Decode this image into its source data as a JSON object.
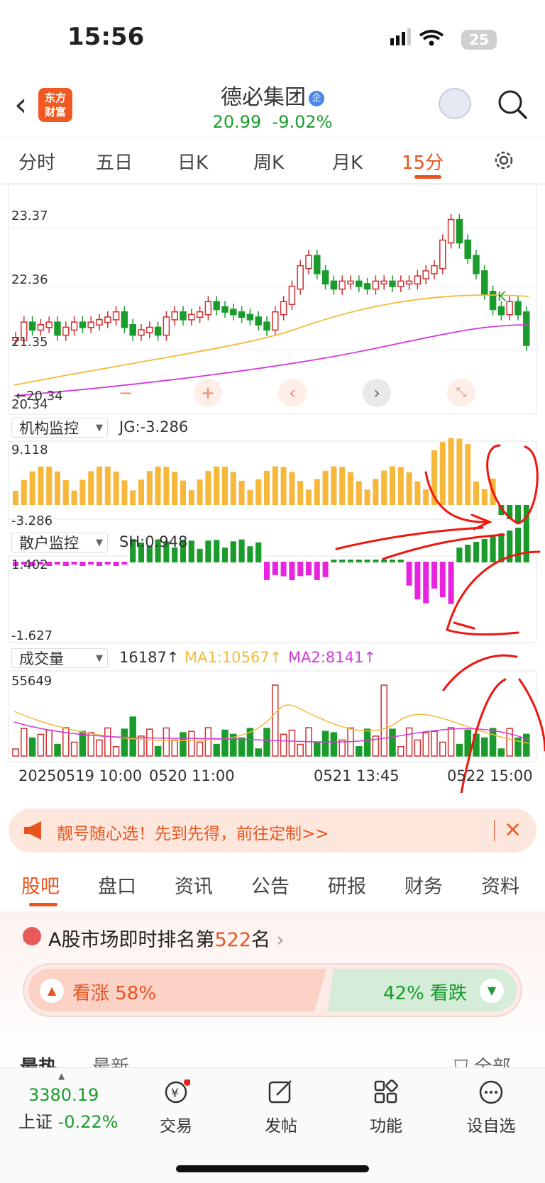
{
  "status": {
    "time": "15:56",
    "battery": "25"
  },
  "header": {
    "logo_line1": "东方",
    "logo_line2": "财富",
    "stock_name": "德必集团",
    "tag": "企",
    "price": "20.99",
    "change": "-9.02%"
  },
  "tabs": [
    "分时",
    "五日",
    "日K",
    "周K",
    "月K",
    "15分"
  ],
  "active_tab": "15分",
  "chart": {
    "price_labels": [
      "23.37",
      "22.36",
      "21.35",
      "20.34",
      "20.34"
    ],
    "k_marker": "K",
    "panel1": {
      "name": "机构监控",
      "value": "JG:-3.286",
      "max": "9.118",
      "min": "-3.286"
    },
    "panel2": {
      "name": "散户监控",
      "value": "SH:0.948",
      "max": "1.402",
      "min": "-1.627"
    },
    "panel3": {
      "name": "成交量",
      "value": "16187↑",
      "ma1": "MA1:10567↑",
      "ma2": "MA2:8141↑",
      "max": "55649"
    },
    "x_labels": [
      "20250519 10:00",
      "0520 11:00",
      "0521 13:45",
      "0522 15:00"
    ],
    "colors": {
      "up": "#d03030",
      "down": "#1a9c2c",
      "ma1": "#f5b93a",
      "ma2": "#d23ad9",
      "jg": "#f7b73a",
      "sh_neg": "#e824e0"
    }
  },
  "chart_data": {
    "type": "bar",
    "title": "",
    "categories": [],
    "y_range_price": [
      20.34,
      23.37
    ],
    "jg_range": [
      -3.286,
      9.118
    ],
    "sh_range": [
      -1.627,
      1.402
    ],
    "volume_max": 55649
  },
  "banner": {
    "text": "靓号随心选！先到先得，前往定制>>"
  },
  "subtabs": [
    "股吧",
    "盘口",
    "资讯",
    "公告",
    "研报",
    "财务",
    "资料"
  ],
  "rank": {
    "prefix": "A股市场即时排名第",
    "number": "522",
    "suffix": "名"
  },
  "vote": {
    "bull": "看涨 58%",
    "bear": "42% 看跌"
  },
  "sort": {
    "hot": "最热",
    "new": "最新",
    "all": "全部"
  },
  "bottom_nav": {
    "index_value": "3380.19",
    "index_name": "上证",
    "index_change": "-0.22%",
    "items": [
      "交易",
      "发帖",
      "功能",
      "设自选"
    ]
  }
}
